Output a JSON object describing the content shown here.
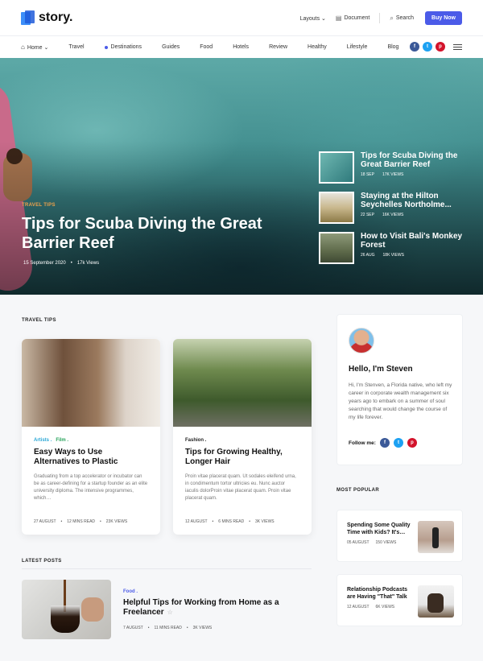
{
  "header": {
    "logo_text": "story.",
    "links": {
      "layouts": "Layouts ⌄",
      "document": "Document",
      "search": "Search",
      "buy_now": "Buy Now"
    }
  },
  "nav": {
    "items": [
      "Home ⌄",
      "Travel",
      "Destinations",
      "Guides",
      "Food",
      "Hotels",
      "Review",
      "Healthy",
      "Lifestyle",
      "Blog"
    ],
    "social": {
      "facebook": "f",
      "twitter": "t",
      "pinterest": "p"
    }
  },
  "hero": {
    "category": "TRAVEL TIPS",
    "title": "Tips for Scuba Diving the Great Barrier Reef",
    "date": "15 September 2020",
    "views": "17k Views",
    "side_posts": [
      {
        "title": "Tips for Scuba Diving the Great Barrier Reef",
        "date": "18 SEP",
        "views": "17K VIEWS"
      },
      {
        "title": "Staying at the Hilton Seychelles Northolme...",
        "date": "22 SEP",
        "views": "16K VIEWS"
      },
      {
        "title": "How to Visit Bali's Monkey Forest",
        "date": "26 AUG",
        "views": "18K VIEWS"
      }
    ]
  },
  "travel_tips": {
    "section_title": "TRAVEL TIPS",
    "cards": [
      {
        "categories": [
          {
            "label": "Artists .",
            "color": "#2aa7d6"
          },
          {
            "label": "Film .",
            "color": "#27a35b"
          }
        ],
        "title": "Easy Ways to Use Alternatives to Plastic",
        "excerpt": "Graduating from a top accelerator or incubator can be as career-defining for a startup founder as an elite university diploma. The intensive programmes, which…",
        "date": "27 AUGUST",
        "read": "12 MINS READ",
        "views": "23K VIEWS"
      },
      {
        "categories": [
          {
            "label": "Fashion .",
            "color": "#222222"
          }
        ],
        "title": "Tips for Growing Healthy, Longer Hair",
        "excerpt": "Proin vitae placerat quam. Ut sodales eleifend urna, in condimentum tortor ultricies eu. Nunc auctor iaculis dolorProin vitae placerat quam. Proin vitae placerat quam.",
        "date": "12 AUGUST",
        "read": "6 MINS READ",
        "views": "3K VIEWS"
      }
    ]
  },
  "latest_posts": {
    "section_title": "LATEST POSTS",
    "post": {
      "category": "Food .",
      "title": "Helpful Tips for Working from Home as a Freelancer",
      "star": "☆",
      "date": "7 AUGUST",
      "read": "11 MINS READ",
      "views": "3K VIEWS"
    }
  },
  "sidebar": {
    "author": {
      "hello": "Hello, I'm Steven",
      "bio": "Hi, I'm Stenven, a Florida native, who left my career in corporate wealth management six years ago to embark on a summer of soul searching that would change the course of my life forever.",
      "follow_label": "Follow me:"
    },
    "most_popular": {
      "section_title": "MOST POPULAR",
      "items": [
        {
          "title": "Spending Some Quality Time with Kids? It's…",
          "date": "05 AUGUST",
          "views": "150 VIEWS"
        },
        {
          "title": "Relationship Podcasts are Having \"That\" Talk",
          "date": "12 AUGUST",
          "views": "6K VIEWS"
        }
      ]
    }
  },
  "colors": {
    "accent": "#4b5be8",
    "hero_category": "#f0a24b"
  }
}
